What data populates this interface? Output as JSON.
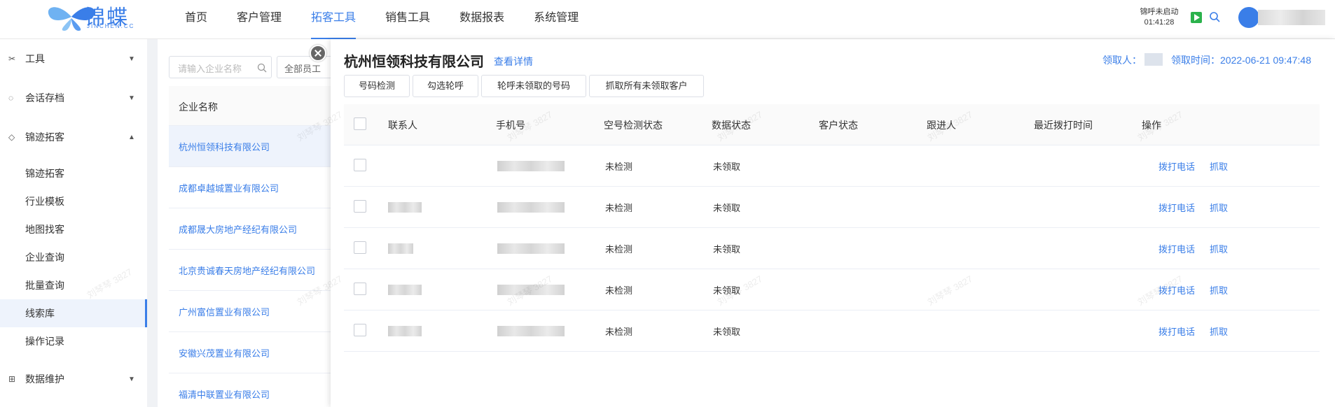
{
  "brand": {
    "name": "锦蝶",
    "sub": "JINCHEN.CC"
  },
  "nav": [
    "首页",
    "客户管理",
    "拓客工具",
    "销售工具",
    "数据报表",
    "系统管理"
  ],
  "header_status": {
    "line1": "锦呼未启动",
    "line2": "01:41:28"
  },
  "sidebar": {
    "groups": [
      {
        "label": "工具"
      },
      {
        "label": "会话存档"
      },
      {
        "label": "锦迹拓客"
      },
      {
        "label": "数据维护"
      }
    ],
    "items": [
      "锦迹拓客",
      "行业模板",
      "地图找客",
      "企业查询",
      "批量查询",
      "线索库",
      "操作记录"
    ]
  },
  "company_list": {
    "search_placeholder": "请输入企业名称",
    "select_value": "全部员工",
    "header": "企业名称",
    "rows": [
      "杭州恒领科技有限公司",
      "成都卓越城置业有限公司",
      "成都晟大房地产经纪有限公司",
      "北京贵诚春天房地产经纪有限公司",
      "广州富信置业有限公司",
      "安徽兴茂置业有限公司",
      "福清中联置业有限公司"
    ]
  },
  "drawer": {
    "title": "杭州恒领科技有限公司",
    "detail_link": "查看详情",
    "claimant_label": "领取人：",
    "claim_time": "领取时间：2022-06-21 09:47:48",
    "buttons": [
      "号码检测",
      "勾选轮呼",
      "轮呼未领取的号码",
      "抓取所有未领取客户"
    ],
    "columns": [
      "联系人",
      "手机号",
      "空号检测状态",
      "数据状态",
      "客户状态",
      "跟进人",
      "最近拨打时间",
      "操作"
    ],
    "rows": [
      {
        "detect": "未检测",
        "data_status": "未领取",
        "call": "拨打电话",
        "grab": "抓取"
      },
      {
        "detect": "未检测",
        "data_status": "未领取",
        "call": "拨打电话",
        "grab": "抓取"
      },
      {
        "detect": "未检测",
        "data_status": "未领取",
        "call": "拨打电话",
        "grab": "抓取"
      },
      {
        "detect": "未检测",
        "data_status": "未领取",
        "call": "拨打电话",
        "grab": "抓取"
      },
      {
        "detect": "未检测",
        "data_status": "未领取",
        "call": "拨打电话",
        "grab": "抓取"
      }
    ]
  },
  "watermark": "刘琴琴 3827",
  "colors": {
    "accent": "#3a7ee8",
    "status_green": "#2bb24c"
  }
}
